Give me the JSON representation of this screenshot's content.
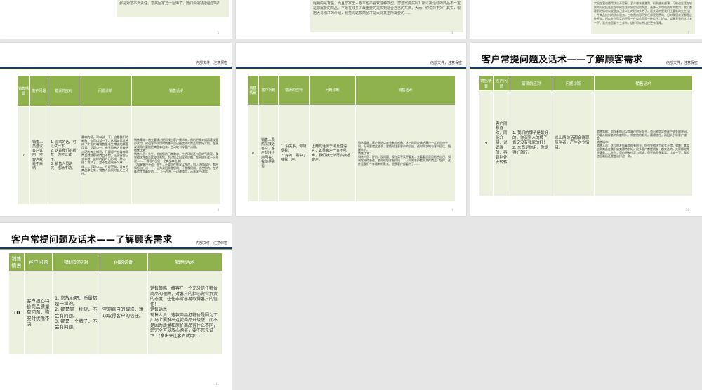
{
  "header": {
    "confidential": "内部文件，注意保密"
  },
  "slides_top": {
    "left_snippet": "那是对您不负责任，您买回家万一后悔了，她们会把钱退给您吗？",
    "left_page": "5",
    "middle_snippet": "促销的是背装，而且您家里人根本也不喜欢这种款型。您还需要买吗？所以挑活动的商品不一定是您需要的商品。不论在线多少最重要的是买到适合自己的东西，大而，你说对不对？其实，根据大哥刚才的介绍，我觉得这款商品才是大哥真正所需要的……",
    "middle_page": "6",
    "right_snippet": "实现在我也懂得优选不容易，及少越来越激烈，料到越来越薄，可能也生活在较繁的时候挂先生在中的生活中所提出的东西，选择一大增的成本和费用。我们都静到的情况以说是自己意义上的理和多劳了。最关键的是我们还要新的先生 这一件商品比别的优价服务，三包费内容不到任都是免费的，但对我们来说都是这种开支。所以先生您买的不是一件商品而是一种信任，好和，如果我到的这边来一下，我先教您第十三条卡，这样可以带比还更有保障。",
    "right_page": "7"
  },
  "table_headers": {
    "scene": "销售情景",
    "question": "客户问题",
    "wrong": "错误的应对",
    "diagnosis": "问题诊断",
    "script": "销售话术"
  },
  "section_title": "客户常提问题及话术——了解顾客需求",
  "slide_7": {
    "scene": "7",
    "question": "销售人员建议客户试用，可客户就是不采纳",
    "wrong": "1. 喜欢的话，可以试一下。\n2. 这是我们的新款，你可以试一下。\n3. 销售人员讲完，陷场不动。",
    "diagnosis": "喜欢的话，可以试一下；这是我们的新款，你可以试一下。这两句话几乎成了中国终端销售里老生常谈的顾客用语。问题点一：由于销售人员缺乏过硬的专业知识，只要客户在看哪款商品就这那款商品不错，让顾客自己去体验，这样的客户已形成一种心理：我试了，是不是会有什么麻烦……问题点二：只说不动，没有把商品拿出来，销售人员同时缺乏主动性。",
    "script": "销售策略：首先要通过提问找出客户需求点，然后把相对机再建议客户试用。建议客户试用时销售人员已经完成对商品的良好介绍，在建议试用时要能把商品拿出来，主动地引导客户试用。\n销售话术：\n销售人员：先生，根据您的日常需求，生活环境还有您的气质呢，我觉得这件商品比较适合您。为了您买回家不后悔，您不妨先试一下再说……(不等客户回答，把商品拿出来)\n（如果客户不动）先生，不管您在哪家买东西，别人讲得再好，都不如您自己试一下。因为买回家是您用，不是我们用，适合您的，在的体验才是最好的……（一边讲，一边递商品，示意客户试用）",
    "page": "8"
  },
  "slide_8": {
    "scene": "8",
    "question": "销售人员热情接近客户，客户却冷冷地回答：我随便看看",
    "wrong": "1. 没关系，你随便看。\n2. 好的，看中了喊我一声。",
    "diagnosis": "上两句话属于消及性语言，如果客户一直不吭声，我们就无法再次接近客户。",
    "script": "销售策略：客户刚进店难免有些戒备，这一阶段应该给客户一定的自由空间，但不要就此放手，要随时注意客户的反应，适时再次地与客户搭话，把握转机。\n销售话术：\n销售人员：好的，没问题，现在买不买不要紧，先看看货是否适合自己，如果您觉得合适，我再给您详细介绍……（如果客户看中某件商品）您好，这件是我们今年最新的款式，很多客户都看中了……",
    "page": "9"
  },
  "slide_9": {
    "scene": "9",
    "question": "客户同意喜欢，同能介绍，说说得一般，再到别处去转转",
    "wrong": "1. 我们的牌子是最好的，你买别人的牌子肯定没有我家的好！\n2. 东西是你用，你觉得好就行。",
    "diagnosis": "以上两句话都会得罪陪伴者，产生对立情绪。",
    "script": "销售策略：陪伴者即可以是客户的好帮手，也可能是导致客户流失的原因。尽量从陪伴者的角度切入，肯定他的眼光，赢得信任，再回头引导客户成交。\n销售话术：\n销售人员：这位朋友您真是很有眼光，您也觉得这个款式不错，对吧？其实这款商品在我们店卖得特别好，很多客户都是朋友一起来选的，大家都觉得很满意……先生，您的朋友也是为您好，您不妨再多看看，比较一下，我相信您最后还是会选择这一款。",
    "page": "10"
  },
  "slide_10": {
    "scene": "10",
    "question": "客户担心特价商品质量有问题，购买时犹豫不决",
    "wrong": "1. 您放心吧，质量都是一样的。\n2. 都是同一批货，不会有问题。\n3. 都是一个牌子，不会有问题。",
    "diagnosis": "空洞直白的解释，难以取得客户的信任。",
    "script": "销售策略：给客户一个充分信任特价商品的理由，对客户的担心做个负责的态度，往往非常容易取得客户的信任！\n销售话术：\n销售人员：这款商品打特价是因为工厂马上要推出这款商品升级版，而不是因为质量和原价商品有什么不同，您完全可以放心购买，要不您先试一下…(拿出来让客户试用！)",
    "page": "11"
  }
}
